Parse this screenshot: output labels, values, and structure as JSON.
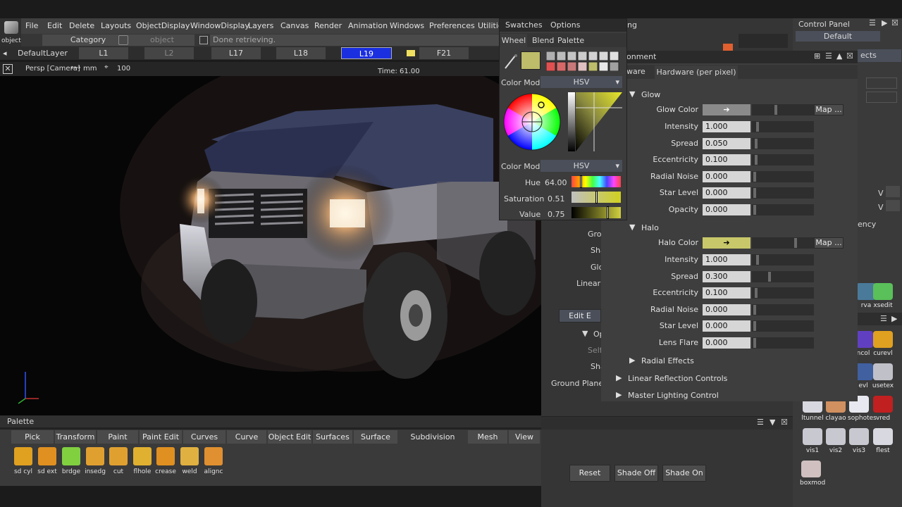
{
  "app": {
    "icon_label": "object"
  },
  "menu": {
    "items": [
      "File",
      "Edit",
      "Delete",
      "Layouts",
      "ObjectDisplay",
      "WindowDisplay",
      "Layers",
      "Canvas",
      "Render",
      "Animation",
      "Windows",
      "Preferences",
      "Utilitie"
    ]
  },
  "controls": {
    "category_label": "Category",
    "object_placeholder": "object",
    "status_text": "Done retrieving."
  },
  "layers": {
    "default_label": "DefaultLayer",
    "items": [
      "L1",
      "L2",
      "L17",
      "L18",
      "L19",
      "F21"
    ]
  },
  "viewport": {
    "camera_label": "Persp [Camera]",
    "units_label": "mm",
    "scale_value": "100",
    "time_label": "Time: 61.00"
  },
  "palette": {
    "title": "Palette",
    "tabs": [
      "Pick",
      "Transform",
      "Paint",
      "Paint Edit",
      "Curves",
      "Curve Edit",
      "Object Edit",
      "Surfaces",
      "Surface Edit",
      "Subdivision",
      "Mesh",
      "View"
    ],
    "active_tab": "Subdivision",
    "tools": [
      "sd cyl",
      "sd ext",
      "brdge",
      "insedg",
      "cut",
      "flhole",
      "crease",
      "weld",
      "alignc"
    ]
  },
  "swatch": {
    "tabs": [
      "Swatches",
      "Options"
    ],
    "subtabs": [
      "Wheel",
      "Blend",
      "Palette"
    ],
    "color_model_label": "Color Model",
    "color_model_value": "HSV",
    "color_model_label2": "Color Model",
    "color_model_value2": "HSV",
    "hue_label": "Hue",
    "hue_value": "64.00",
    "sat_label": "Saturation",
    "sat_value": "0.51",
    "val_label": "Value",
    "val_value": "0.75",
    "current_color": "#bdbd6a",
    "hue_fraction": 0.178,
    "sat_fraction": 0.51,
    "val_fraction": 0.75
  },
  "env": {
    "title_partial": "onment",
    "tab_partial": "ware",
    "tab_active": "Hardware (per pixel)",
    "glow": {
      "label": "Glow",
      "color_label": "Glow Color",
      "map_label": "Map ...",
      "rows": [
        {
          "label": "Intensity",
          "value": "1.000",
          "f": 0.05
        },
        {
          "label": "Spread",
          "value": "0.050",
          "f": 0.02
        },
        {
          "label": "Eccentricity",
          "value": "0.100",
          "f": 0.02
        },
        {
          "label": "Radial Noise",
          "value": "0.000",
          "f": 0.0
        },
        {
          "label": "Star Level",
          "value": "0.000",
          "f": 0.0
        },
        {
          "label": "Opacity",
          "value": "0.000",
          "f": 0.0
        }
      ]
    },
    "halo": {
      "label": "Halo",
      "color_label": "Halo Color",
      "map_label": "Map ...",
      "color": "#c8c86a",
      "rows": [
        {
          "label": "Intensity",
          "value": "1.000",
          "f": 0.05
        },
        {
          "label": "Spread",
          "value": "0.300",
          "f": 0.25
        },
        {
          "label": "Eccentricity",
          "value": "0.100",
          "f": 0.02
        },
        {
          "label": "Radial Noise",
          "value": "0.000",
          "f": 0.0
        },
        {
          "label": "Star Level",
          "value": "0.000",
          "f": 0.0
        },
        {
          "label": "Lens Flare",
          "value": "0.000",
          "f": 0.0
        }
      ]
    },
    "radial_effects": "Radial Effects",
    "linear_reflection": "Linear Reflection Controls",
    "master_lighting": "Master Lighting Control"
  },
  "midpanel": {
    "partial_rows": [
      "Grou",
      "Sha",
      "Glo",
      "Linear R",
      "Edit E",
      "Op",
      "Self",
      "Sha",
      "Ground Plane Re"
    ],
    "reset_label": "Reset",
    "shade_off_label": "Shade Off",
    "shade_on_label": "Shade On",
    "top_partial": "ng"
  },
  "control_panel": {
    "title": "Control Panel",
    "layout_value": "Default",
    "partial_objects": "ects",
    "partial_ency": "ency",
    "v_label": "V"
  },
  "shelf": {
    "items_row1": [
      "rva",
      "xsedit"
    ],
    "items_row2": [
      "ncol",
      "curevl"
    ],
    "items_row3": [
      "evl",
      "usetex"
    ],
    "items_row4": [
      "ltunnel",
      "clayao",
      "sophotes",
      "vred"
    ],
    "items_row5": [
      "vis1",
      "vis2",
      "vis3",
      "flest"
    ],
    "items_row6": [
      "boxmod"
    ]
  }
}
